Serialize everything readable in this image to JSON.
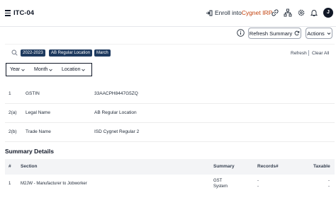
{
  "header": {
    "title": "ITC-04",
    "enroll_prefix": "Enroll into ",
    "enroll_accent": "Cygnet IRP",
    "avatar_initial": "J"
  },
  "toolbar": {
    "refresh_summary_label": "Refresh Summary",
    "actions_label": "Actions"
  },
  "filters": {
    "chips": [
      "2022-2023",
      "AB Regular Location",
      "March"
    ],
    "refresh_label": "Refresh",
    "clear_all_label": "Clear All",
    "dropdowns": [
      "Year",
      "Month",
      "Location"
    ]
  },
  "details": [
    {
      "no": "1",
      "label": "GSTIN",
      "value": "33AACPH8447G5ZQ"
    },
    {
      "no": "2(a)",
      "label": "Legal Name",
      "value": "AB Regular Location"
    },
    {
      "no": "2(b)",
      "label": "Trade Name",
      "value": "ISD Cygnet Regular 2"
    }
  ],
  "summary": {
    "title": "Summary Details",
    "columns": [
      "#",
      "Section",
      "Summary",
      "Records#",
      "Taxable"
    ],
    "rows": [
      {
        "no": "1",
        "section": "M2JW - Manufacturer to Jobworker",
        "summary": [
          "GST",
          "System"
        ],
        "records": [
          "-",
          "-"
        ],
        "taxable": [
          "-",
          "-"
        ]
      }
    ]
  },
  "colors": {
    "accent": "#c2410c",
    "chip_bg": "#1e3a5f"
  }
}
